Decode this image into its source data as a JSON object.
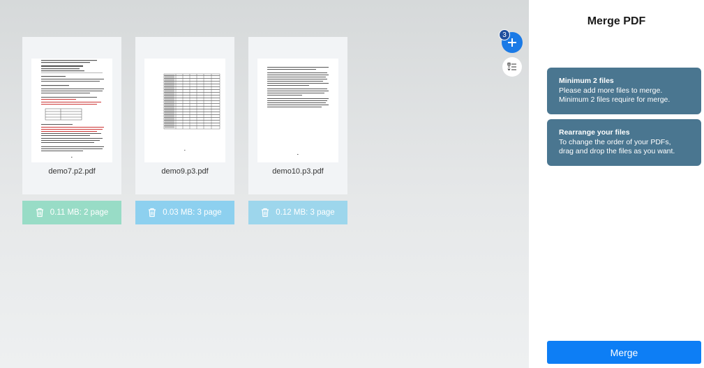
{
  "files": [
    {
      "name": "demo7.p2.pdf",
      "info": "0.11 MB: 2 page",
      "bar_color": "#98dcc6"
    },
    {
      "name": "demo9.p3.pdf",
      "info": "0.03 MB: 3 page",
      "bar_color": "#8dd0ef"
    },
    {
      "name": "demo10.p3.pdf",
      "info": "0.12 MB: 3 page",
      "bar_color": "#9dd6ec"
    }
  ],
  "toolbar": {
    "file_count": "3",
    "add_icon": "plus-icon",
    "sort_icon": "sort-list-icon"
  },
  "sidebar": {
    "title": "Merge PDF",
    "tips": [
      {
        "title": "Minimum 2 files",
        "line1": "Please add more files to merge.",
        "line2": "Minimum 2 files require for merge."
      },
      {
        "title": "Rearrange your files",
        "line1": "To change the order of your PDFs,",
        "line2": "drag and drop the files as you want."
      }
    ],
    "merge_label": "Merge"
  },
  "colors": {
    "accent": "#0d7ef5",
    "tip_bg": "#4a7690",
    "add_button": "#1a7ae6"
  }
}
